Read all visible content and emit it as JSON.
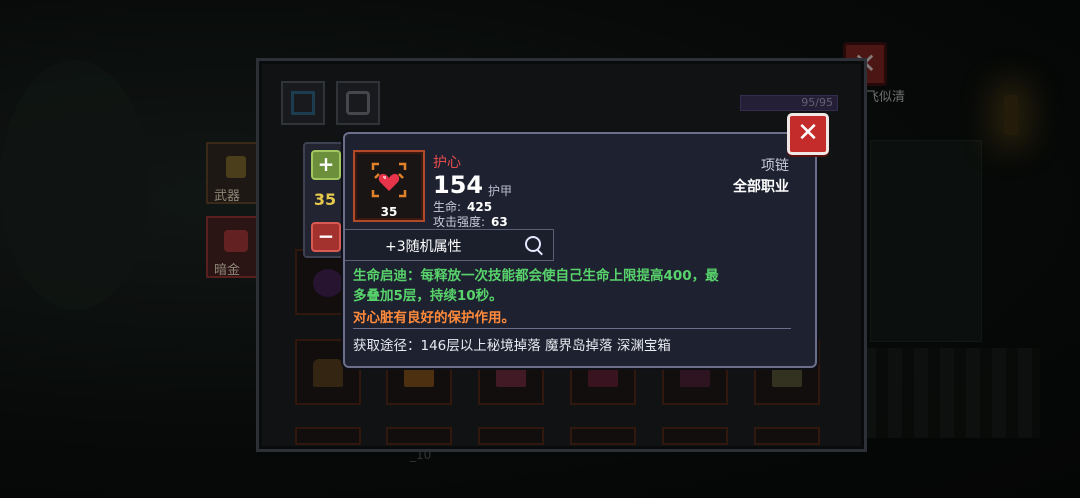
{
  "scene": {
    "background_name": "飞似清",
    "footer_fragment": "_10"
  },
  "inventory": {
    "capacity": "95/95",
    "capacity_fraction": 1.0,
    "side_slots": [
      {
        "label": "武器",
        "icon": "weapon-icon"
      },
      {
        "label": "暗金",
        "icon": "dark-gold-icon"
      }
    ],
    "tabs": [
      {
        "icon": "equipment-tab-icon"
      },
      {
        "icon": "armor-tab-icon"
      }
    ]
  },
  "quantity": {
    "value": "35",
    "plus": "+",
    "minus": "−"
  },
  "item": {
    "name": "护心",
    "level": "35",
    "armor_value": "154",
    "armor_label": "护甲",
    "slot_type": "项链",
    "class_type": "全部职业",
    "stats": [
      {
        "label": "生命:",
        "value": "425"
      },
      {
        "label": "攻击强度:",
        "value": "63"
      }
    ],
    "random_attr": "+3随机属性",
    "effect_line1": "生命启迪：每释放一次技能都会使自己生命上限提高400，最",
    "effect_line2": "多叠加5层，持续10秒。",
    "flavor": "对心脏有良好的保护作用。",
    "source": "获取途径：146层以上秘境掉落 魔界岛掉落 深渊宝箱"
  },
  "colors": {
    "name_red": "#e44b4b",
    "effect_green": "#58d36b",
    "flavor_orange": "#ff8a3a",
    "level_yellow": "#e6c84a"
  }
}
